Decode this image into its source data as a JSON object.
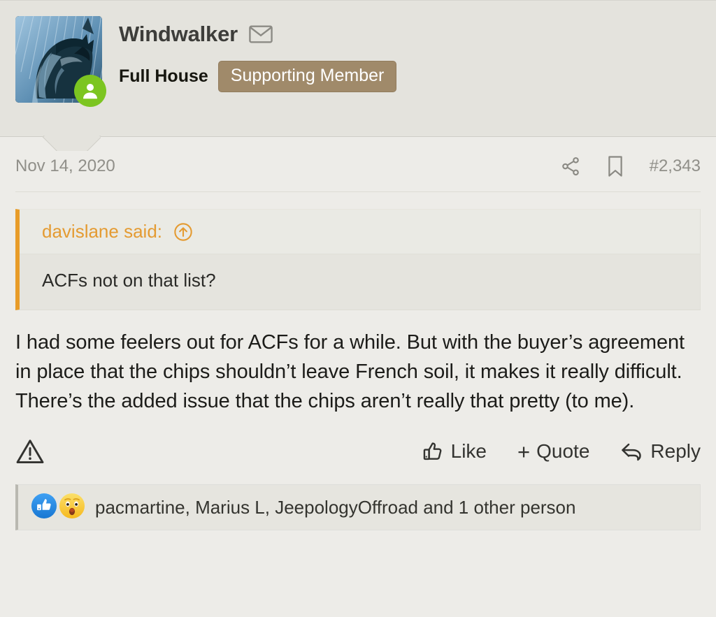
{
  "post": {
    "author": {
      "username": "Windwalker",
      "user_title": "Full House",
      "badge": "Supporting Member",
      "pm_icon": "envelope-icon",
      "online_status_icon": "user-online-icon",
      "avatar_alt": "batman-avatar"
    },
    "meta": {
      "date": "Nov 14, 2020",
      "share_icon": "share-icon",
      "bookmark_icon": "bookmark-icon",
      "post_number": "#2,343"
    },
    "quote": {
      "author_label": "davislane said:",
      "jump_icon": "circle-up-arrow-icon",
      "text": "ACFs not on that list?"
    },
    "message": "I had some feelers out for ACFs for a while. But with the buyer’s agreement in place that the chips shouldn’t leave French soil, it makes it really difficult. There’s the added issue that the chips aren’t really that pretty (to me).",
    "actions": {
      "report_icon": "warning-triangle-icon",
      "like_label": "Like",
      "like_icon": "thumbs-up-icon",
      "quote_label": "Quote",
      "quote_plus": "+",
      "reply_label": "Reply",
      "reply_icon": "reply-arrow-icon"
    },
    "reactions": {
      "emoji_like": "like-reaction-icon",
      "emoji_wow": "wow-reaction-icon",
      "text": "pacmartine, Marius L, JeepologyOffroad and 1 other person"
    }
  },
  "colors": {
    "page_bg": "#edece8",
    "header_bg": "#e4e3dd",
    "badge_bg": "#a08a6a",
    "quote_accent": "#e89c28",
    "quote_author": "#e49b32",
    "online_green": "#7cc521",
    "muted_text": "#908f89",
    "body_text": "#1c1c19"
  }
}
